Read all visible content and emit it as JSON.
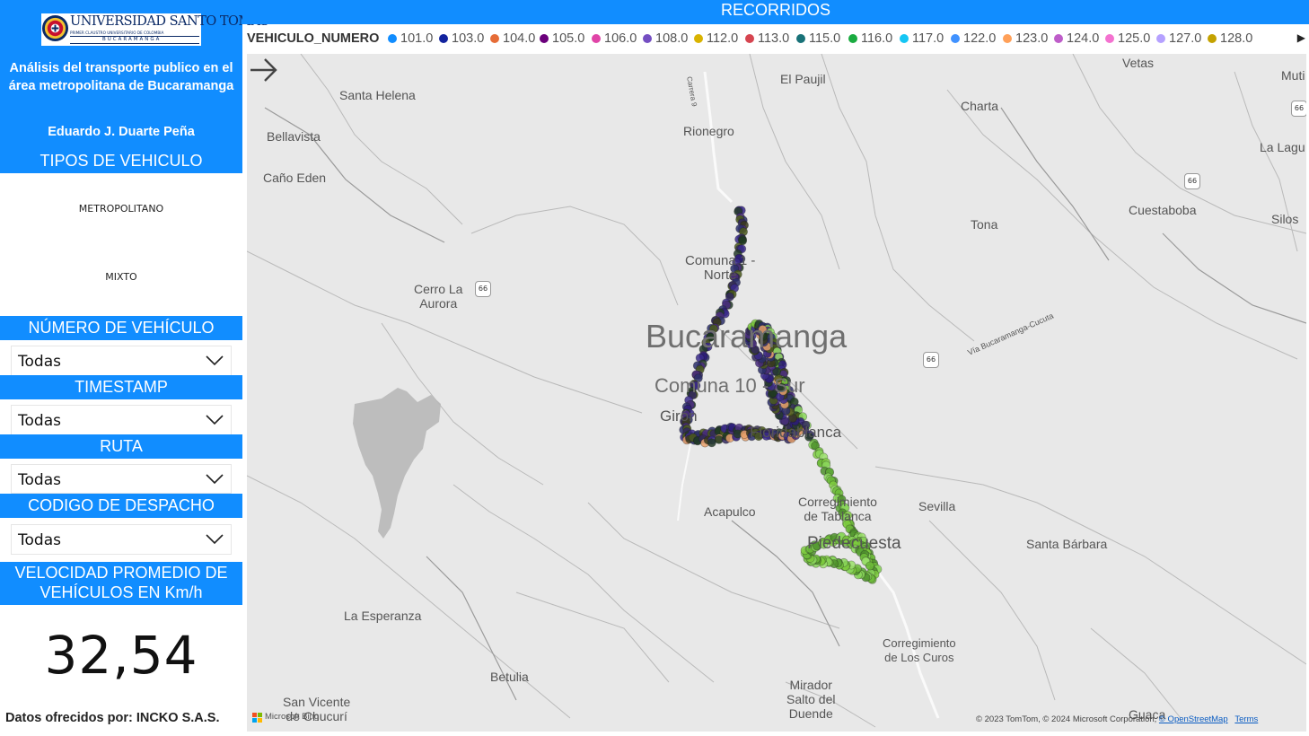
{
  "header": {
    "logo": {
      "name": "UNIVERSIDAD SANTO TOMAS",
      "subtitle": "PRIMER CLAUSTRO UNIVERSITARIO DE COLOMBIA",
      "city": "BUCARAMANGA",
      "icon": "university-seal-icon"
    },
    "title": "Análisis del transporte publico en el área metropolitana de Bucaramanga",
    "author": "Eduardo J. Duarte Peña"
  },
  "filters": {
    "tipos": {
      "label": "TIPOS DE VEHICULO",
      "items": [
        "METROPOLITANO",
        "MIXTO"
      ]
    },
    "numero": {
      "label": "NÚMERO DE VEHÍCULO",
      "value": "Todas"
    },
    "timestamp": {
      "label": "TIMESTAMP",
      "value": "Todas"
    },
    "ruta": {
      "label": "RUTA",
      "value": "Todas"
    },
    "codigo": {
      "label": "CODIGO DE DESPACHO",
      "value": "Todas"
    }
  },
  "kpi": {
    "label": "VELOCIDAD PROMEDIO DE VEHÍCULOS EN Km/h",
    "value": "32,54"
  },
  "footer": {
    "source": "Datos ofrecidos por: INCKO S.A.S."
  },
  "map_visual": {
    "title": "RECORRIDOS",
    "legend_title": "VEHICULO_NUMERO",
    "legend": [
      {
        "label": "101.0",
        "color": "#118dff"
      },
      {
        "label": "103.0",
        "color": "#12239e"
      },
      {
        "label": "104.0",
        "color": "#e66c37"
      },
      {
        "label": "105.0",
        "color": "#6b007b"
      },
      {
        "label": "106.0",
        "color": "#e044a7"
      },
      {
        "label": "108.0",
        "color": "#744ec2"
      },
      {
        "label": "112.0",
        "color": "#d9b300"
      },
      {
        "label": "113.0",
        "color": "#d64550"
      },
      {
        "label": "115.0",
        "color": "#197278"
      },
      {
        "label": "116.0",
        "color": "#1aab40"
      },
      {
        "label": "117.0",
        "color": "#15c6f4"
      },
      {
        "label": "122.0",
        "color": "#4092ff"
      },
      {
        "label": "123.0",
        "color": "#ffa058"
      },
      {
        "label": "124.0",
        "color": "#be5dc9"
      },
      {
        "label": "125.0",
        "color": "#f472d0"
      },
      {
        "label": "127.0",
        "color": "#b5a1ff"
      },
      {
        "label": "128.0",
        "color": "#c4a200"
      }
    ],
    "places": {
      "santa_helena": "Santa Helena",
      "el_paujil": "El Paujil",
      "charta": "Charta",
      "vetas": "Vetas",
      "mutiscua": "Muti",
      "bellavista": "Bellavista",
      "rionegro": "Rionegro",
      "la_laguna": "La Lagu",
      "cano_eden": "Caño Eden",
      "cuestaboba": "Cuestaboba",
      "silos": "Silos",
      "tona": "Tona",
      "comuna1_l1": "Comuna 1 -",
      "comuna1_l2": "Norte",
      "cerro_l1": "Cerro La",
      "cerro_l2": "Aurora",
      "bucaramanga": "Bucaramanga",
      "comuna_sur": "Comuna 10 - Sur",
      "giron": "Girón",
      "floridablanca": "Floridablanca",
      "via": "Vía Bucaramanga-Cucuta",
      "acapulco": "Acapulco",
      "tabl_l1": "Corregimiento",
      "tabl_l2": "de Tablanca",
      "sevilla": "Sevilla",
      "piedecuesta": "Piedecuesta",
      "santa_barbara": "Santa Bárbara",
      "la_esperanza": "La Esperanza",
      "curos_l1": "Corregimiento",
      "curos_l2": "de Los Curos",
      "betulia": "Betulia",
      "mirador_l1": "Mirador",
      "mirador_l2": "Salto del",
      "mirador_l3": "Duende",
      "svc_l1": "San Vicente",
      "svc_l2": "de Chucurí",
      "guaca": "Guaca",
      "carrera": "Carrera 9"
    },
    "shields": {
      "s66a": "66",
      "s66b": "66",
      "s66c": "66",
      "s66d": "66"
    },
    "attribution": {
      "text": "© 2023 TomTom, © 2024 Microsoft Corporation,",
      "osm": "© OpenStreetMap",
      "terms": "Terms"
    },
    "microsoft": "Microsoft Bing"
  }
}
